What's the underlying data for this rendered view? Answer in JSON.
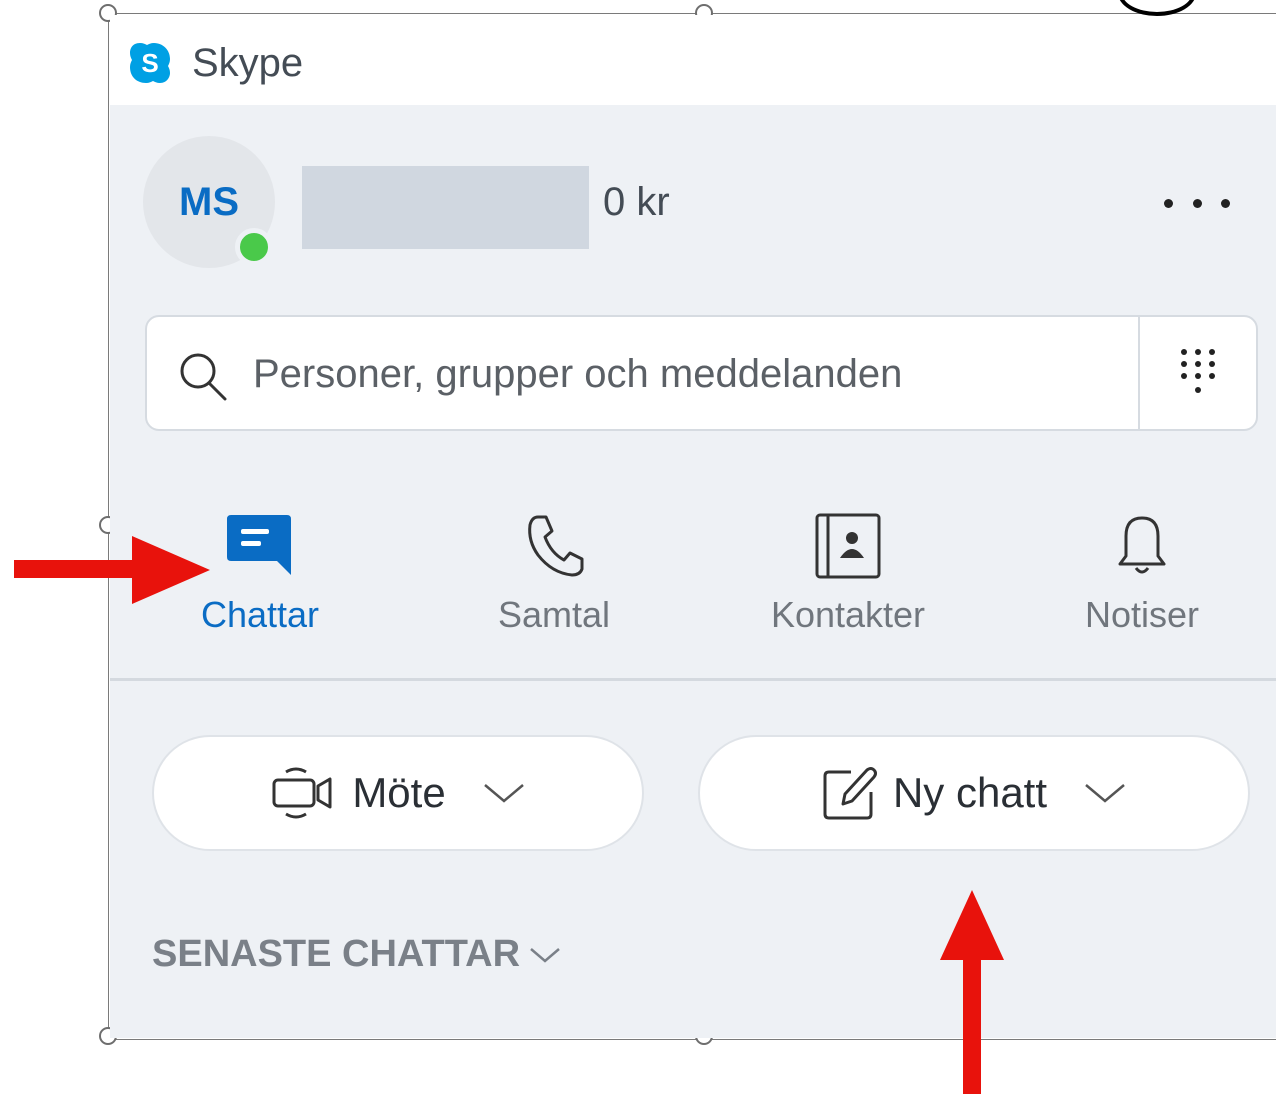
{
  "app": {
    "title": "Skype",
    "logo_letter": "S"
  },
  "profile": {
    "initials": "MS",
    "presence": "online",
    "credit": "0 kr",
    "more_icon": "more-horizontal-icon"
  },
  "search": {
    "placeholder": "Personer, grupper och meddelanden",
    "icon": "search-icon",
    "dialpad_icon": "dialpad-icon"
  },
  "nav": {
    "tabs": [
      {
        "label": "Chattar",
        "icon": "chat-icon",
        "active": true
      },
      {
        "label": "Samtal",
        "icon": "phone-icon",
        "active": false
      },
      {
        "label": "Kontakter",
        "icon": "contacts-icon",
        "active": false
      },
      {
        "label": "Notiser",
        "icon": "bell-icon",
        "active": false
      }
    ]
  },
  "actions": {
    "meeting_label": "Möte",
    "new_chat_label": "Ny chatt"
  },
  "recent_chats": {
    "header": "SENASTE CHATTAR"
  },
  "colors": {
    "accent": "#0a6cc4",
    "annotation_arrow": "#e8120c",
    "presence_online": "#4ac94a"
  }
}
